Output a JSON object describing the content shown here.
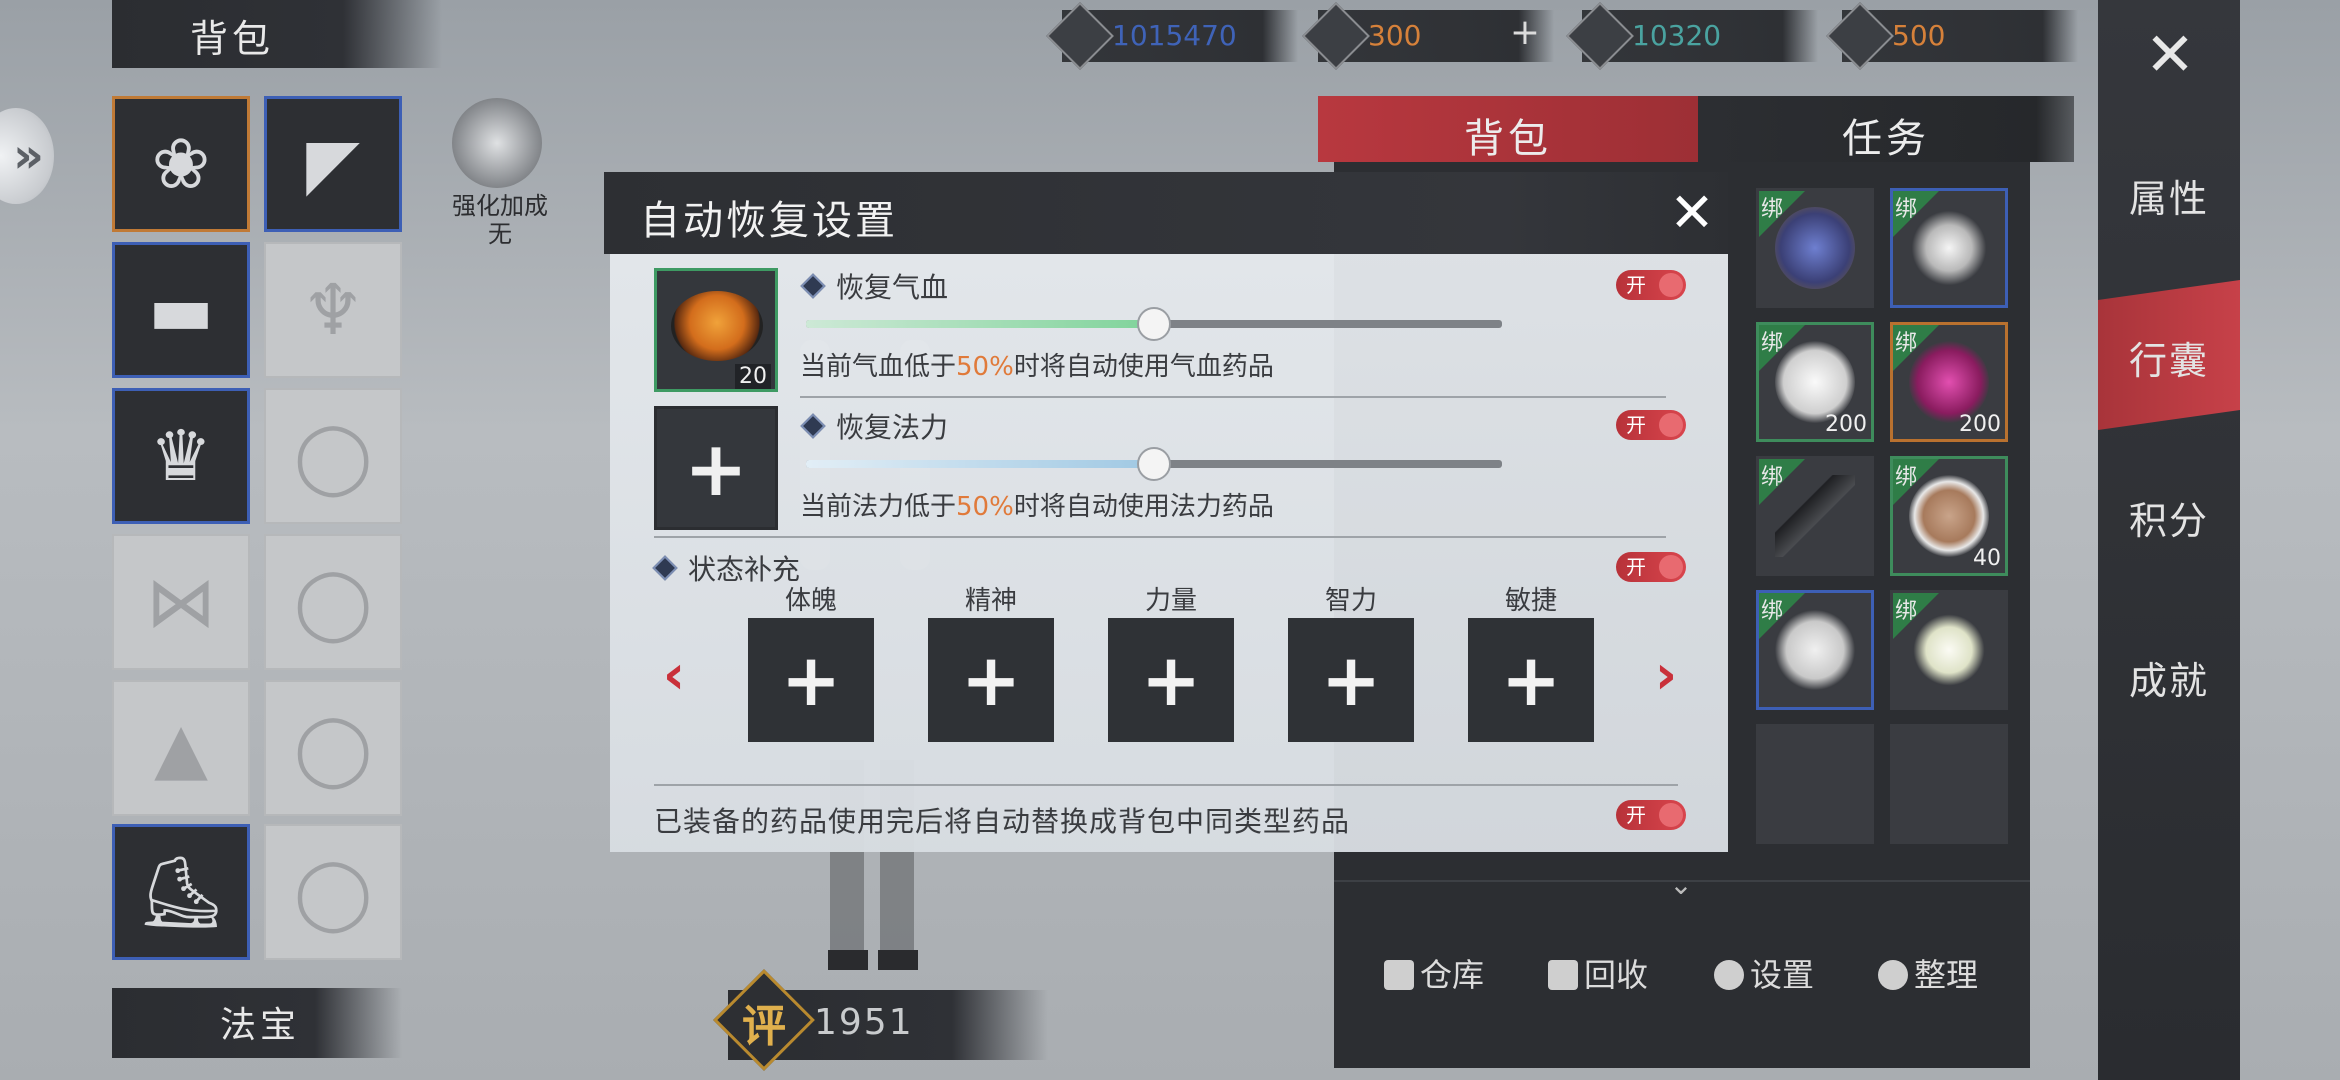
{
  "left_panel": {
    "title": "背包",
    "enhance_line1": "强化加成",
    "enhance_line2": "无",
    "fabao_label": "法宝",
    "score_badge": "评",
    "score_value": "1951"
  },
  "currencies": [
    {
      "name": "coin-icon",
      "value": "1015470",
      "color": "#3f63b8"
    },
    {
      "name": "ticket-icon",
      "value": "300",
      "color": "#d6813a"
    },
    {
      "name": "silver-icon",
      "value": "10320",
      "color": "#4aa3a0"
    },
    {
      "name": "gold-icon",
      "value": "500",
      "color": "#d6813a"
    }
  ],
  "currency_plus": "+",
  "right_nav": {
    "close": "✕",
    "items": [
      "属性",
      "行囊",
      "积分",
      "成就"
    ],
    "active": "行囊"
  },
  "inventory": {
    "tabs": [
      "背包",
      "任务"
    ],
    "active_tab": "背包",
    "bind_tag": "绑",
    "counts": {
      "potion_white": "200",
      "potion_purple": "200",
      "dish": "40"
    },
    "footer": [
      "仓库",
      "回收",
      "设置",
      "整理"
    ]
  },
  "modal": {
    "title": "自动恢复设置",
    "close": "✕",
    "hp": {
      "label": "恢复气血",
      "toggle": "开",
      "percent": 50,
      "desc_pre": "当前气血低于",
      "desc_val": "50%",
      "desc_post": "时将自动使用气血药品",
      "item_count": "20"
    },
    "mp": {
      "label": "恢复法力",
      "toggle": "开",
      "percent": 50,
      "desc_pre": "当前法力低于",
      "desc_val": "50%",
      "desc_post": "时将自动使用法力药品"
    },
    "buff": {
      "label": "状态补充",
      "toggle": "开",
      "stats": [
        "体魄",
        "精神",
        "力量",
        "智力",
        "敏捷"
      ]
    },
    "auto_replace": {
      "text": "已装备的药品使用完后将自动替换成背包中同类型药品",
      "toggle": "开"
    },
    "colors": {
      "accent": "#c9303a",
      "highlight": "#e07a3a",
      "hp_fill": "#7fd39a",
      "mp_fill": "#9fc8e3"
    }
  }
}
